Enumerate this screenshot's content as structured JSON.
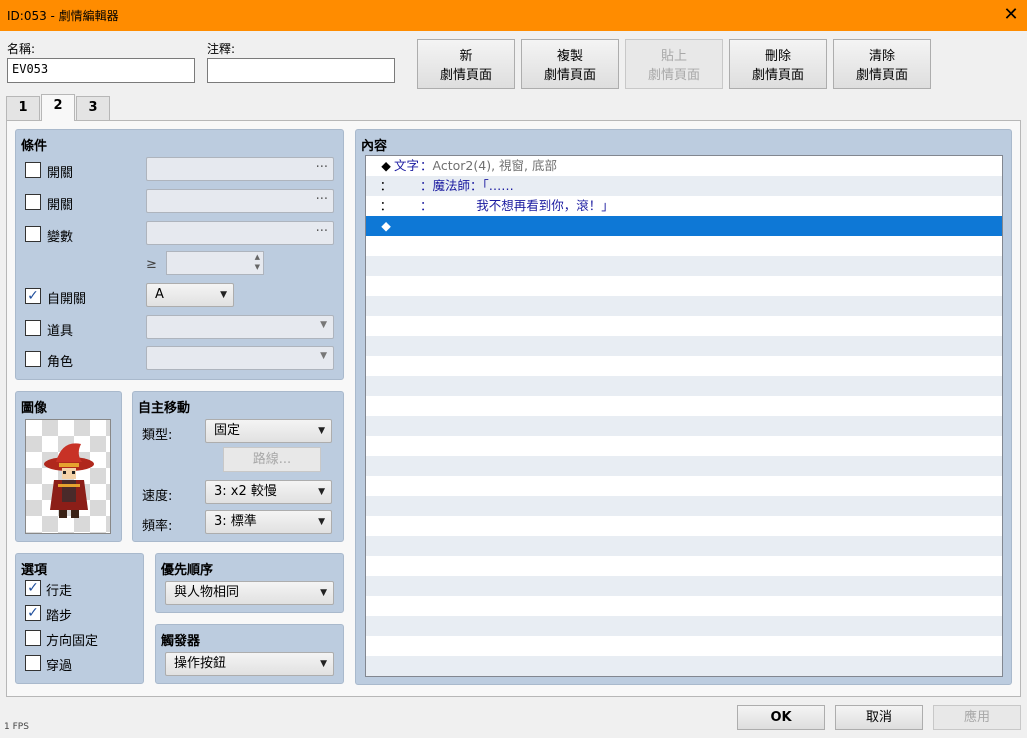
{
  "window": {
    "title": "ID:053 - 劇情編輯器",
    "close_symbol": "✕"
  },
  "name": {
    "label": "名稱:",
    "value": "EV053"
  },
  "note": {
    "label": "注釋:",
    "value": ""
  },
  "top_buttons": [
    {
      "line1": "新",
      "line2": "劇情頁面",
      "enabled": true
    },
    {
      "line1": "複製",
      "line2": "劇情頁面",
      "enabled": true
    },
    {
      "line1": "貼上",
      "line2": "劇情頁面",
      "enabled": false
    },
    {
      "line1": "刪除",
      "line2": "劇情頁面",
      "enabled": true
    },
    {
      "line1": "清除",
      "line2": "劇情頁面",
      "enabled": true
    }
  ],
  "tabs": [
    "1",
    "2",
    "3"
  ],
  "active_tab": "2",
  "conditions": {
    "title": "條件",
    "switch1": {
      "label": "開關",
      "checked": false,
      "dots": "···"
    },
    "switch2": {
      "label": "開關",
      "checked": false,
      "dots": "···"
    },
    "variable": {
      "label": "變數",
      "checked": false,
      "dots": "···"
    },
    "ge_symbol": "≥",
    "self_switch": {
      "label": "自開關",
      "checked": true,
      "value": "A"
    },
    "item": {
      "label": "道具",
      "checked": false
    },
    "actor": {
      "label": "角色",
      "checked": false
    }
  },
  "image": {
    "title": "圖像"
  },
  "autonomous": {
    "title": "自主移動",
    "type_label": "類型:",
    "type_value": "固定",
    "route_button": "路線...",
    "speed_label": "速度:",
    "speed_value": "3: x2 較慢",
    "freq_label": "頻率:",
    "freq_value": "3: 標準"
  },
  "options": {
    "title": "選項",
    "items": [
      {
        "label": "行走",
        "checked": true
      },
      {
        "label": "踏步",
        "checked": true
      },
      {
        "label": "方向固定",
        "checked": false
      },
      {
        "label": "穿過",
        "checked": false
      }
    ]
  },
  "priority": {
    "title": "優先順序",
    "value": "與人物相同"
  },
  "trigger": {
    "title": "觸發器",
    "value": "操作按鈕"
  },
  "content": {
    "title": "內容",
    "rows": [
      {
        "mark": "◆",
        "cmd": "文字",
        "sep": "：",
        "text": "Actor2(4), 視窗, 底部"
      },
      {
        "mark": "：",
        "cmd": "",
        "sep": "：",
        "text": "魔法師：「……"
      },
      {
        "mark": "：",
        "cmd": "",
        "sep": "：",
        "text": "           我不想再看到你，滾！」"
      },
      {
        "mark": "◆",
        "cmd": "",
        "sep": "",
        "text": ""
      }
    ],
    "total_rows": 26,
    "selected_row": 3
  },
  "bottom_buttons": {
    "ok": "OK",
    "cancel": "取消",
    "apply": "應用"
  },
  "fps": "1 FPS",
  "colors": {
    "titlebar": "#ff8c00",
    "group_bg": "#bcccdf",
    "selection": "#0e78d6",
    "command_text": "#1a1aa0",
    "param_text": "#707070"
  }
}
